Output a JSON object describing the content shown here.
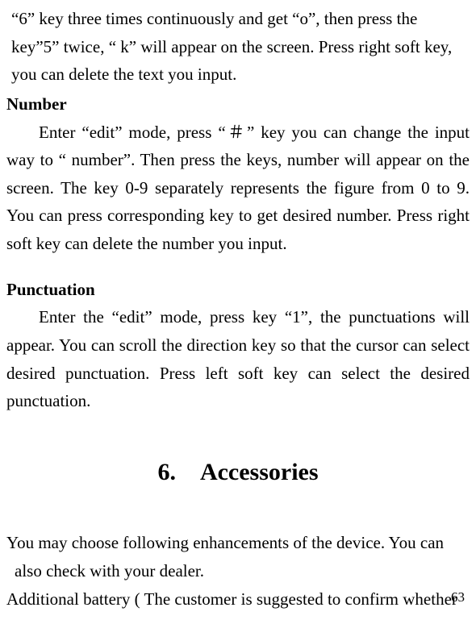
{
  "intro": {
    "line1": "“6” key three times continuously and get “o”, then press the",
    "line2": "key”5” twice, “ k” will appear on the screen. Press right soft key,",
    "line3": "you can delete the text you input."
  },
  "number": {
    "heading": "Number",
    "body": "Enter “edit” mode, press “＃” key you can change the input way to “ number”. Then press the keys, number will appear on the screen. The key 0-9 separately represents the figure from 0 to 9. You can press corresponding key to get desired number. Press right soft key can delete the number you input."
  },
  "punctuation": {
    "heading": "Punctuation",
    "body": "Enter the “edit” mode, press key “1”, the punctuations will appear. You can scroll the direction key so that the cursor can select desired punctuation. Press left soft key can select the desired punctuation."
  },
  "section": {
    "title": "6. Accessories"
  },
  "accessories": {
    "line1": "You may choose following enhancements of the device. You can",
    "line2": "also check with your dealer.",
    "line3": "Additional battery ( The customer is suggested to confirm whether"
  },
  "page_number": "63"
}
